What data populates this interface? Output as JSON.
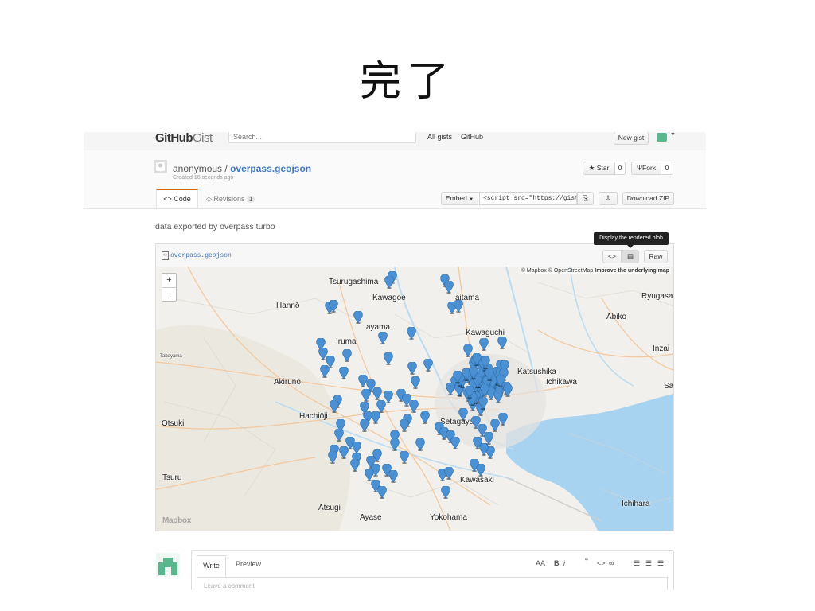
{
  "slide": {
    "title": "完了"
  },
  "header": {
    "logo_bold": "GitHub",
    "logo_thin": "Gist",
    "search_placeholder": "Search...",
    "nav": [
      "All gists",
      "GitHub"
    ],
    "new_gist": "New gist"
  },
  "gist": {
    "owner": "anonymous",
    "separator": "/",
    "name": "overpass.geojson",
    "created": "Created 16 seconds ago",
    "star_label": "Star",
    "star_count": "0",
    "fork_label": "Fork",
    "fork_count": "0"
  },
  "tabs": {
    "code": "Code",
    "revisions": "Revisions",
    "revisions_count": "1"
  },
  "embed": {
    "label": "Embed",
    "value": "<script src=\"https://gist.",
    "download": "Download ZIP"
  },
  "description": "data exported by overpass turbo",
  "file": {
    "name": "overpass.geojson",
    "tooltip": "Display the rendered blob",
    "raw": "Raw"
  },
  "map": {
    "attribution_1": "© Mapbox © OpenStreetMap",
    "attribution_2": "Improve the underlying map",
    "zoom_in": "+",
    "zoom_out": "−",
    "logo": "Mapbox",
    "labels": {
      "tsurugashima": "Tsurugashima",
      "kawagoe": "Kawagoe",
      "hanno": "Hannō",
      "saitama": "aitama",
      "ryugasaki": "Ryugasa",
      "abiko": "Abiko",
      "sayama": "ayama",
      "kawaguchi": "Kawaguchi",
      "iruma": "Iruma",
      "tabayama": "Tabayama",
      "inzai": "Inzai",
      "katsushika": "Katsushika",
      "ichikawa": "Ichikawa",
      "akiruno": "Akiruno",
      "sa": "Sa",
      "hachioji": "Hachiōji",
      "setagaya": "Setagaya",
      "otsuki": "Otsuki",
      "tsuru": "Tsuru",
      "kawasaki": "Kawasaki",
      "ichihara": "Ichihara",
      "atsugi": "Atsugi",
      "ayase": "Ayase",
      "yokohama": "Yokohama"
    },
    "marker_color": "#4a90d2"
  },
  "comment": {
    "write": "Write",
    "preview": "Preview",
    "placeholder": "Leave a comment",
    "format_size": "AA",
    "bold": "B",
    "italic": "i",
    "quote": "“",
    "code": "<>",
    "link": "∞",
    "ul": "☰",
    "ol": "☰",
    "tasks": "☰"
  }
}
